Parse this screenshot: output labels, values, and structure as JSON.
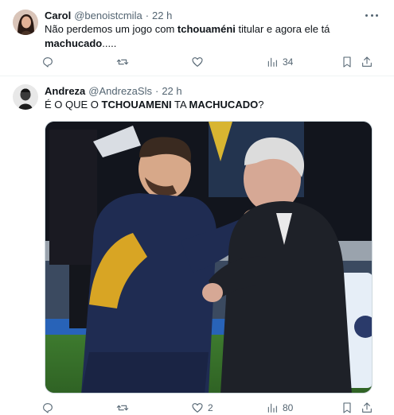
{
  "tweets": [
    {
      "name": "Carol",
      "handle": "@benoistcmila",
      "separator": "·",
      "time": "22 h",
      "text_before": "Não perdemos um jogo com ",
      "text_bold": "tchouaméni",
      "text_middle": " titular e agora ele tá ",
      "text_bold2": "machucado",
      "text_after": ".....",
      "views": "34",
      "reply_count": "",
      "repost_count": "",
      "like_count": ""
    },
    {
      "name": "Andreza",
      "handle": "@AndrezaSls",
      "separator": "·",
      "time": "22 h",
      "text_before": "É O QUE O ",
      "text_bold": "TCHOUAMENI",
      "text_middle": " TA ",
      "text_bold2": "MACHUCADO",
      "text_after": "?",
      "likes": "2",
      "views": "80",
      "reply_count": "",
      "repost_count": ""
    }
  ],
  "icons": {
    "reply": "reply-icon",
    "repost": "repost-icon",
    "like": "heart-icon",
    "views": "views-icon",
    "bookmark": "bookmark-icon",
    "share": "share-icon",
    "more": "more-icon"
  },
  "colors": {
    "text": "#0f1419",
    "secondary": "#536471",
    "divider": "#eff3f4"
  }
}
